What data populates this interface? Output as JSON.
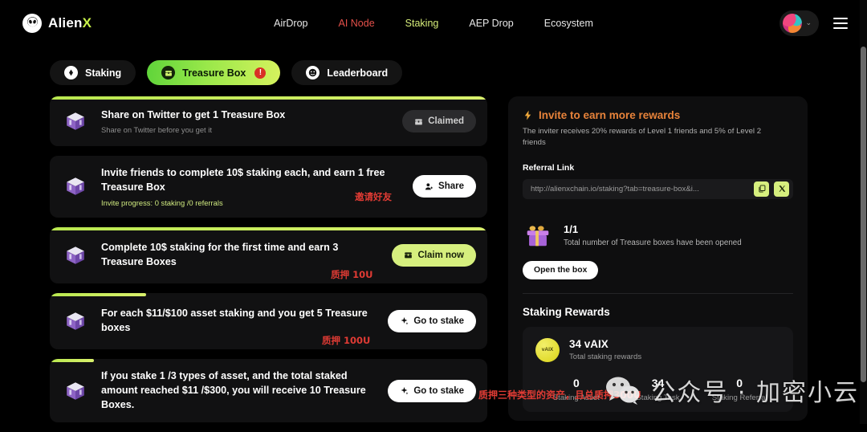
{
  "header": {
    "logo_text": "Alien",
    "logo_accent": "X",
    "logo_icon": "alien-head-icon",
    "nav": [
      {
        "label": "AirDrop",
        "state": "default"
      },
      {
        "label": "AI Node",
        "state": "red"
      },
      {
        "label": "Staking",
        "state": "green"
      },
      {
        "label": "AEP Drop",
        "state": "default"
      },
      {
        "label": "Ecosystem",
        "state": "default"
      }
    ],
    "chevron": "⌄",
    "menu_icon": "hamburger-menu-icon"
  },
  "tabs": [
    {
      "label": "Staking",
      "icon": "diamond-icon",
      "active": false
    },
    {
      "label": "Treasure Box",
      "icon": "treasure-chest-icon",
      "active": true,
      "badge": "!"
    },
    {
      "label": "Leaderboard",
      "icon": "trophy-face-icon",
      "active": false
    }
  ],
  "tasks": [
    {
      "title": "Share on Twitter to get 1 Treasure Box",
      "subtitle": "Share on Twitter before you get it",
      "subtitle_style": "gray",
      "progress_pct": 100,
      "button": "Claimed",
      "button_style": "claimed",
      "button_icon": "chest-icon",
      "note": ""
    },
    {
      "title": "Invite friends to complete 10$ staking each, and earn 1 free Treasure Box",
      "subtitle": "Invite progress: 0 staking /0 referrals",
      "subtitle_style": "lime",
      "progress_pct": 0,
      "button": "Share",
      "button_style": "white",
      "button_icon": "person-add-icon",
      "note": "邀请好友"
    },
    {
      "title": "Complete 10$ staking for the first time and earn 3 Treasure Boxes",
      "subtitle": "",
      "subtitle_style": "gray",
      "progress_pct": 100,
      "button": "Claim now",
      "button_style": "lime",
      "button_icon": "chest-icon",
      "note": "质押 10U"
    },
    {
      "title": "For each $11/$100 asset staking and you get 5 Treasure boxes",
      "subtitle": "",
      "subtitle_style": "gray",
      "progress_pct": 22,
      "button": "Go to stake",
      "button_style": "white",
      "button_icon": "sparkle-icon",
      "note": "质押 100U"
    },
    {
      "title": "If you stake 1 /3 types of asset, and the total staked amount reached $11 /$300, you will receive 10 Treasure Boxes.",
      "subtitle": "",
      "subtitle_style": "gray",
      "progress_pct": 10,
      "button": "Go to stake",
      "button_style": "white",
      "button_icon": "sparkle-icon",
      "note": ""
    }
  ],
  "invite": {
    "icon": "lightning-bolt-icon",
    "heading": "Invite to earn more rewards",
    "description": "The inviter receives 20% rewards of Level 1 friends and 5% of Level 2 friends",
    "referral_label": "Referral Link",
    "referral_link": "http://alienxchain.io/staking?tab=treasure-box&i...",
    "copy_icon": "copy-icon",
    "share_x_icon": "x-twitter-icon"
  },
  "treasure": {
    "gift_icon": "gift-box-icon",
    "count": "1/1",
    "caption": "Total number of Treasure boxes have been opened",
    "open_button": "Open the box"
  },
  "rewards": {
    "title": "Staking Rewards",
    "coin_symbol": "vAIX",
    "amount": "34 vAIX",
    "caption": "Total staking rewards",
    "stats": [
      {
        "value": "0",
        "label": "Staking Asset"
      },
      {
        "value": "34",
        "label": "Staking Task"
      },
      {
        "value": "0",
        "label": "Staking Referral"
      }
    ]
  },
  "annotations": {
    "bottom_note": "质押三种类型的资产，且总质押300U"
  },
  "watermark": {
    "logo": "wechat-icon",
    "text": "公众号 · 加密小云"
  },
  "colors": {
    "accent_lime": "#d6ef7e",
    "accent_green": "#9ae84a",
    "accent_red": "#e5504a",
    "accent_orange": "#e8833a",
    "note_red": "#e03b34",
    "background": "#000000"
  }
}
